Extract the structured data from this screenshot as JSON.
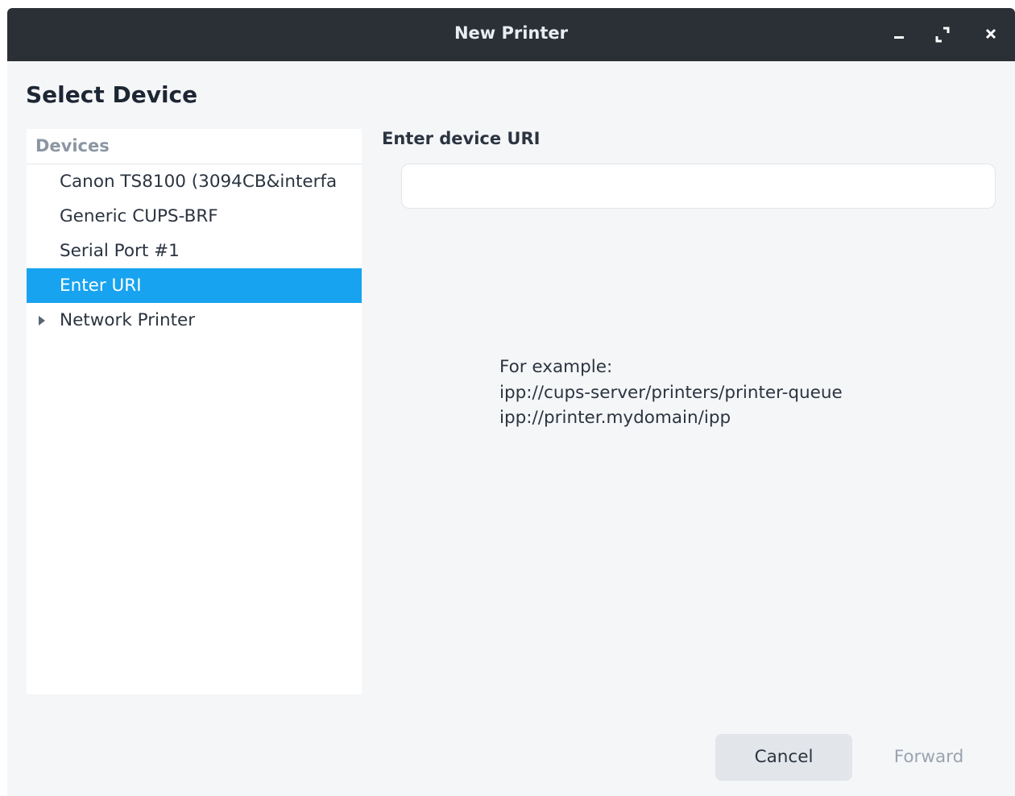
{
  "window": {
    "title": "New Printer",
    "controls": [
      {
        "name": "minimize-button",
        "icon": "minimize-icon"
      },
      {
        "name": "maximize-button",
        "icon": "maximize-icon"
      },
      {
        "name": "close-button",
        "icon": "close-icon"
      }
    ]
  },
  "page": {
    "heading": "Select Device"
  },
  "devices": {
    "header": "Devices",
    "items": [
      {
        "label": "Canon TS8100 (3094CB&interfa",
        "selected": false,
        "expandable": false
      },
      {
        "label": "Generic CUPS-BRF",
        "selected": false,
        "expandable": false
      },
      {
        "label": "Serial Port #1",
        "selected": false,
        "expandable": false
      },
      {
        "label": "Enter URI",
        "selected": true,
        "expandable": false
      },
      {
        "label": "Network Printer",
        "selected": false,
        "expandable": true
      }
    ]
  },
  "uri": {
    "label": "Enter device URI",
    "value": "",
    "placeholder": ""
  },
  "example": {
    "intro": "For example:",
    "lines": [
      "ipp://cups-server/printers/printer-queue",
      "ipp://printer.mydomain/ipp"
    ]
  },
  "buttons": {
    "cancel": "Cancel",
    "forward": "Forward"
  },
  "colors": {
    "titlebar": "#2b3036",
    "selection": "#17a3ef",
    "background": "#f5f6f8",
    "disabled_text": "#9aa3ae"
  }
}
